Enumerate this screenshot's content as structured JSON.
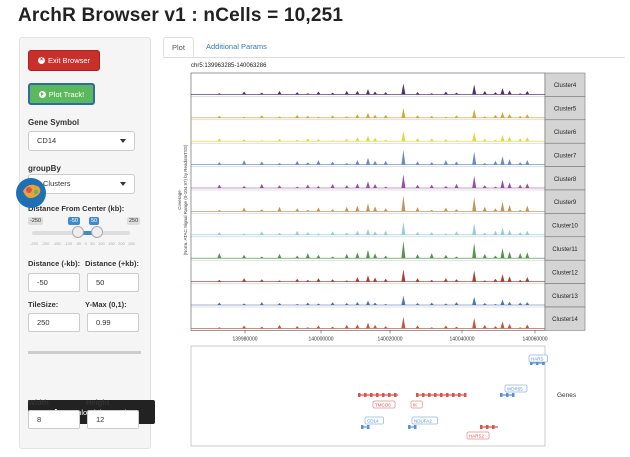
{
  "title": "ArchR Browser v1 : nCells = 10,251",
  "sidebar": {
    "exit_label": "Exit Browser",
    "plot_label": "Plot Track!",
    "gene_symbol_label": "Gene Symbol",
    "gene_symbol_value": "CD14",
    "groupby_label": "groupBy",
    "groupby_value": "Clusters",
    "distance_center_label": "Distance From Center (kb):",
    "slider_min": "-250",
    "slider_max": "250",
    "slider_low": "-50",
    "slider_high": "50",
    "slider_ticks": [
      "-250",
      "-200",
      "-150",
      "-100",
      "-50",
      "0",
      "50",
      "100",
      "150",
      "200",
      "250"
    ],
    "dist_minus_label": "Distance (-kb):",
    "dist_plus_label": "Distance (+kb):",
    "dist_minus_value": "-50",
    "dist_plus_value": "50",
    "tilesize_label": "TileSize:",
    "ymax_label": "Y-Max (0,1):",
    "tilesize_value": "250",
    "ymax_value": "0.99",
    "download_label": "Download the Track!",
    "width_label": "Width",
    "height_label": "Height",
    "width_value": "8",
    "height_value": "12"
  },
  "tabs": [
    {
      "label": "Plot",
      "active": true
    },
    {
      "label": "Additional Params",
      "active": false
    }
  ],
  "plot": {
    "region": "chr5:139963285-140063286",
    "ylabel_1": "Coverage",
    "ylabel_2": "(Norm. ATAC Signal Range (0-104.97) by ReadsInTSS)",
    "x_ticks": [
      "139980000",
      "140000000",
      "140020000",
      "140040000",
      "140060000"
    ],
    "genes_label": "Genes",
    "clusters": [
      {
        "name": "Cluster4",
        "color": "#3d1a5c"
      },
      {
        "name": "Cluster5",
        "color": "#c9a227"
      },
      {
        "name": "Cluster6",
        "color": "#e6cf2a"
      },
      {
        "name": "Cluster7",
        "color": "#5a7fb8"
      },
      {
        "name": "Cluster8",
        "color": "#8e3b9c"
      },
      {
        "name": "Cluster9",
        "color": "#b8894f"
      },
      {
        "name": "Cluster10",
        "color": "#8ec7d6"
      },
      {
        "name": "Cluster11",
        "color": "#3f8a3a"
      },
      {
        "name": "Cluster12",
        "color": "#9a3020"
      },
      {
        "name": "Cluster13",
        "color": "#3a66a8"
      },
      {
        "name": "Cluster14",
        "color": "#b8462a"
      }
    ],
    "gene_tags": [
      {
        "label": "HARS",
        "color": "#5b8fd6"
      },
      {
        "label": "TMCO6",
        "color": "#d9534f"
      },
      {
        "label": "IK",
        "color": "#d9534f"
      },
      {
        "label": "WDR55",
        "color": "#5b8fd6"
      },
      {
        "label": "CD14",
        "color": "#5b8fd6"
      },
      {
        "label": "NDUFA2",
        "color": "#5b8fd6"
      },
      {
        "label": "HARS2",
        "color": "#d9534f"
      }
    ]
  }
}
